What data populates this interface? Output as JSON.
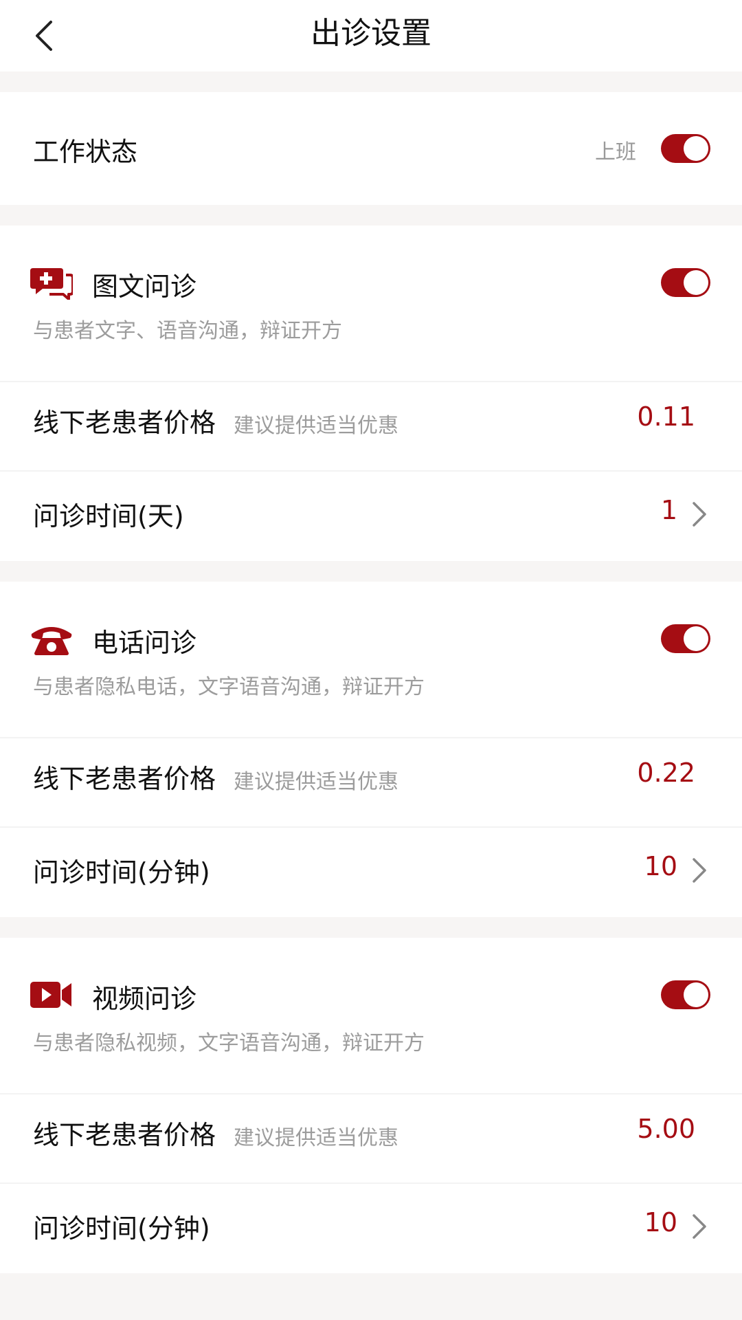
{
  "header": {
    "title": "出诊设置"
  },
  "work_status": {
    "label": "工作状态",
    "status": "上班",
    "enabled": true
  },
  "sections": [
    {
      "icon": "chat-medical-icon",
      "title": "图文问诊",
      "description": "与患者文字、语音沟通，辩证开方",
      "enabled": true,
      "price_label": "线下老患者价格",
      "price_hint": "建议提供适当优惠",
      "price_value": "0.11",
      "time_label": "问诊时间(天)",
      "time_value": "1"
    },
    {
      "icon": "telephone-icon",
      "title": "电话问诊",
      "description": "与患者隐私电话，文字语音沟通，辩证开方",
      "enabled": true,
      "price_label": "线下老患者价格",
      "price_hint": "建议提供适当优惠",
      "price_value": "0.22",
      "time_label": "问诊时间(分钟)",
      "time_value": "10"
    },
    {
      "icon": "video-camera-icon",
      "title": "视频问诊",
      "description": "与患者隐私视频，文字语音沟通，辩证开方",
      "enabled": true,
      "price_label": "线下老患者价格",
      "price_hint": "建议提供适当优惠",
      "price_value": "5.00",
      "time_label": "问诊时间(分钟)",
      "time_value": "10"
    }
  ],
  "colors": {
    "accent": "#a50d13",
    "background": "#f7f5f4"
  }
}
